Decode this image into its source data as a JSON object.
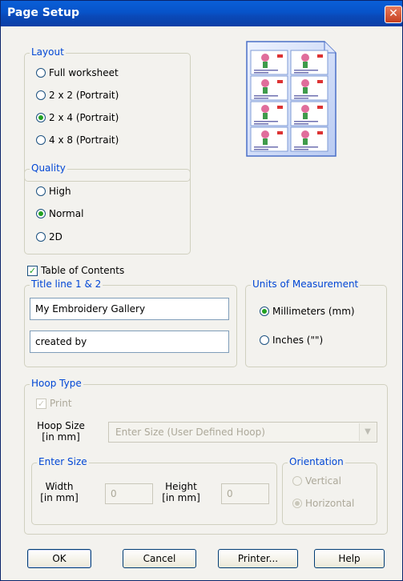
{
  "window": {
    "title": "Page Setup",
    "close_glyph": "✕"
  },
  "layout": {
    "legend": "Layout",
    "options": [
      "Full worksheet",
      "2 x 2 (Portrait)",
      "2 x 4 (Portrait)",
      "4 x 8 (Portrait)"
    ],
    "selected": "2 x 4 (Portrait)"
  },
  "quality": {
    "legend": "Quality",
    "options": [
      "High",
      "Normal",
      "2D"
    ],
    "selected": "Normal"
  },
  "toc": {
    "label": "Table of Contents",
    "checked": true
  },
  "title_lines": {
    "legend": "Title line 1 & 2",
    "line1": "My Embroidery Gallery",
    "line2": "created by"
  },
  "units": {
    "legend": "Units of Measurement",
    "options": [
      "Millimeters (mm)",
      "Inches (\"\")"
    ],
    "selected": "Millimeters (mm)"
  },
  "hoop": {
    "legend": "Hoop Type",
    "print_label": "Print",
    "print_checked": true,
    "size_label": "Hoop Size\n[in mm]",
    "size_label_line1": "Hoop Size",
    "size_label_line2": "[in mm]",
    "size_value": "Enter Size (User Defined Hoop)",
    "enter_size": {
      "legend": "Enter Size",
      "width_line1": "Width",
      "width_line2": "[in mm]",
      "width_value": "0",
      "height_line1": "Height",
      "height_line2": "[in mm]",
      "height_value": "0"
    },
    "orientation": {
      "legend": "Orientation",
      "options": [
        "Vertical",
        "Horizontal"
      ],
      "selected": "Horizontal"
    }
  },
  "buttons": {
    "ok": "OK",
    "cancel": "Cancel",
    "printer": "Printer...",
    "help": "Help"
  },
  "colors": {
    "title_bar": "#0753c9",
    "legend_text": "#0046d5",
    "radio_check": "#21a121",
    "close": "#c5401f"
  }
}
